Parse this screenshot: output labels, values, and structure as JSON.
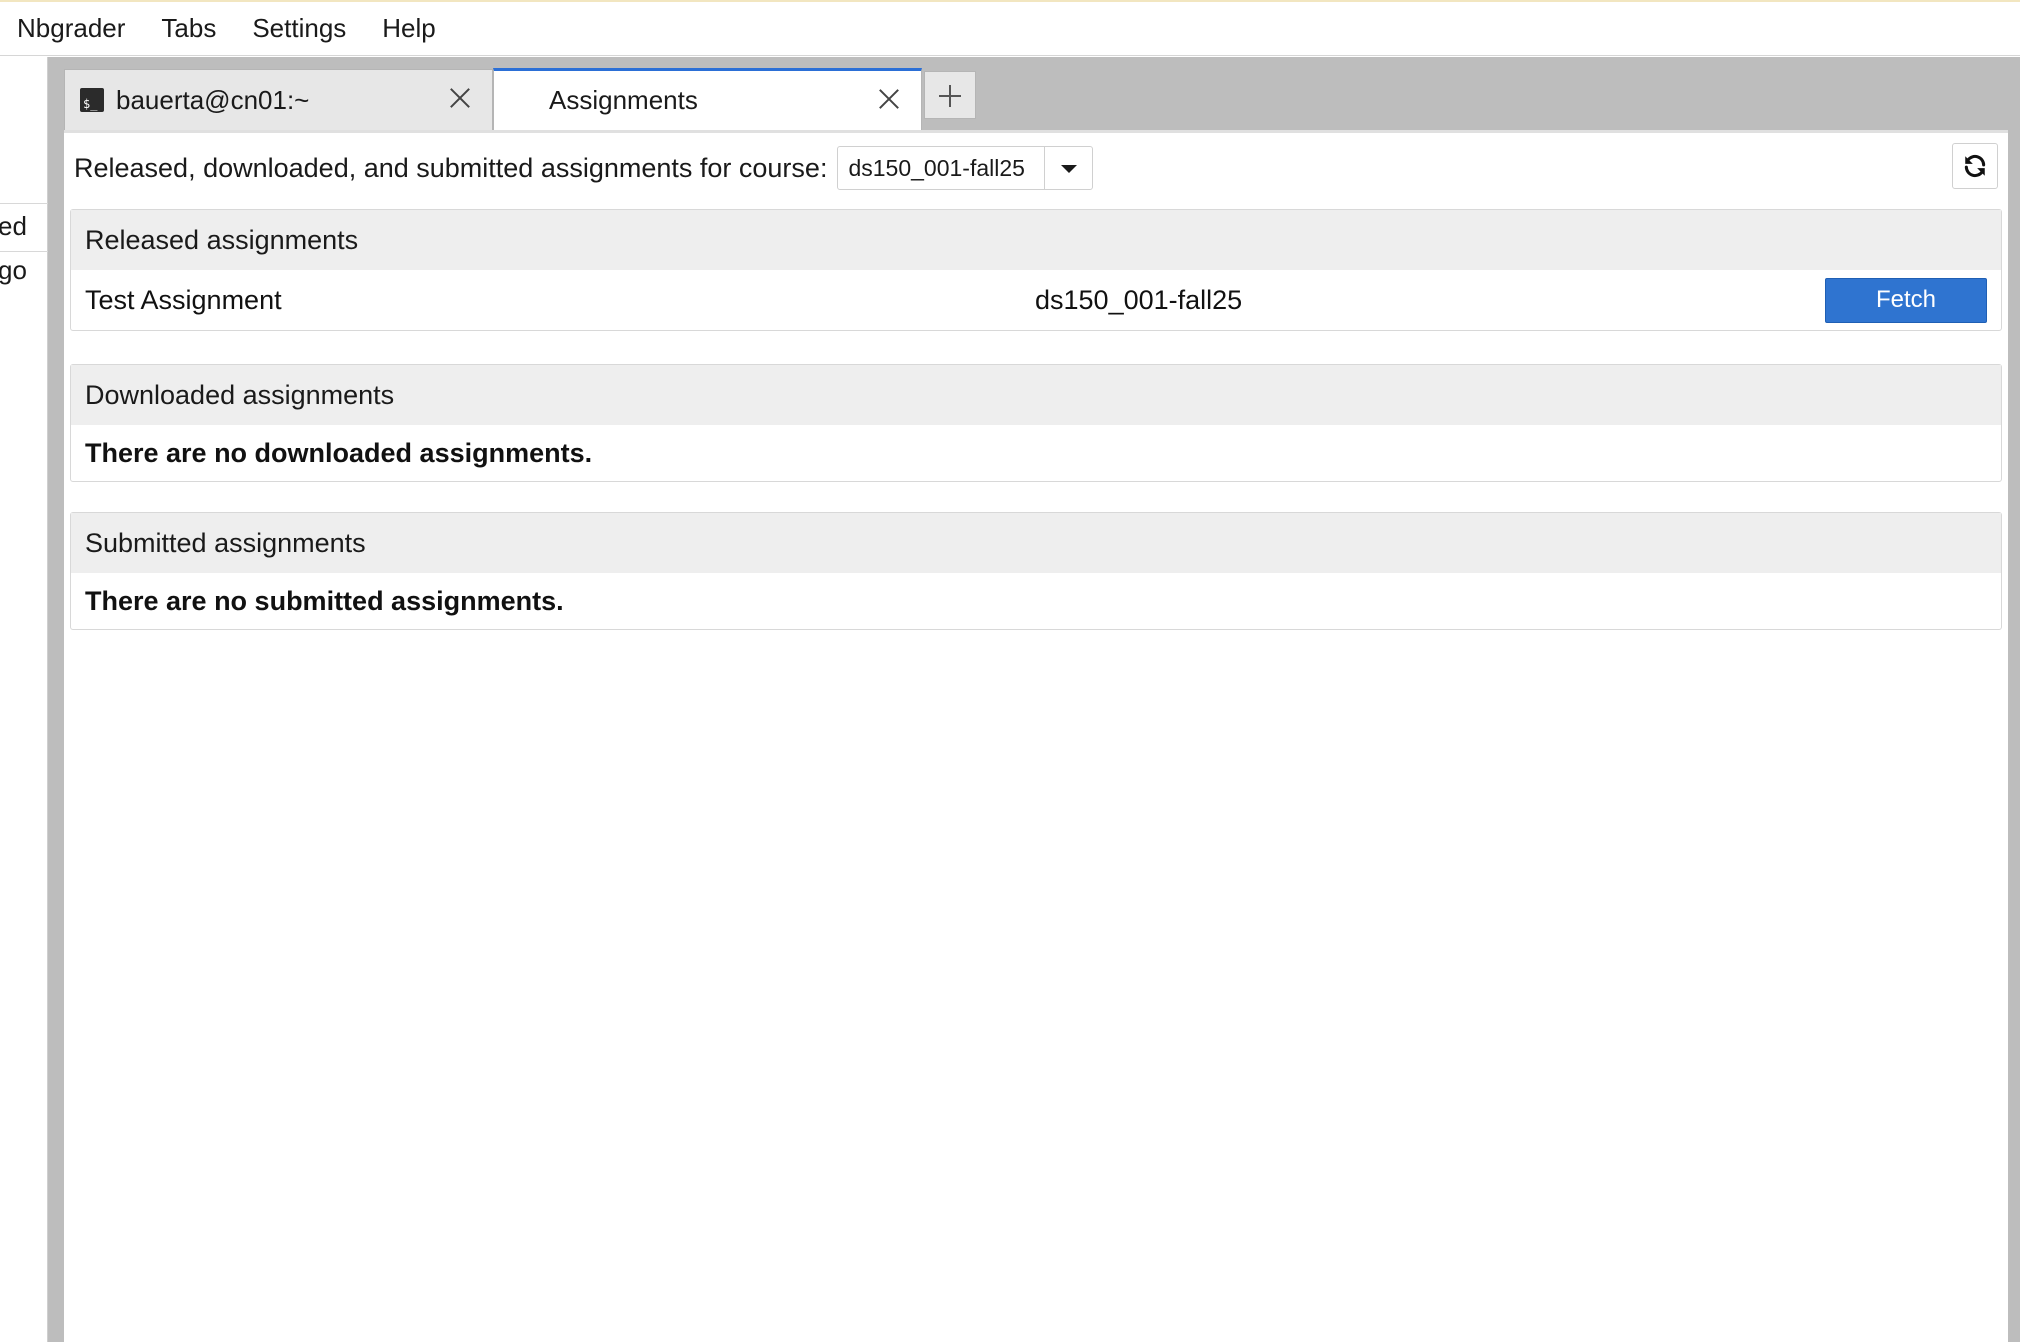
{
  "menu": {
    "items": [
      {
        "label": "Nbgrader"
      },
      {
        "label": "Tabs"
      },
      {
        "label": "Settings"
      },
      {
        "label": "Help"
      }
    ]
  },
  "sidebar": {
    "fragments": [
      "ed",
      "go"
    ]
  },
  "tabs": [
    {
      "label": "bauerta@cn01:~",
      "icon": "terminal-icon",
      "active": false
    },
    {
      "label": "Assignments",
      "active": true
    }
  ],
  "course": {
    "label": "Released, downloaded, and submitted assignments for course:",
    "selected": "ds150_001-fall25"
  },
  "sections": {
    "released": {
      "title": "Released assignments",
      "rows": [
        {
          "name": "Test Assignment",
          "course": "ds150_001-fall25",
          "action": "Fetch"
        }
      ]
    },
    "downloaded": {
      "title": "Downloaded assignments",
      "empty_message": "There are no downloaded assignments."
    },
    "submitted": {
      "title": "Submitted assignments",
      "empty_message": "There are no submitted assignments."
    }
  },
  "colors": {
    "accent": "#2f74d0",
    "active_tab_border": "#2b6fd6",
    "dock_background": "#bdbdbd",
    "section_header": "#eeeeee"
  }
}
